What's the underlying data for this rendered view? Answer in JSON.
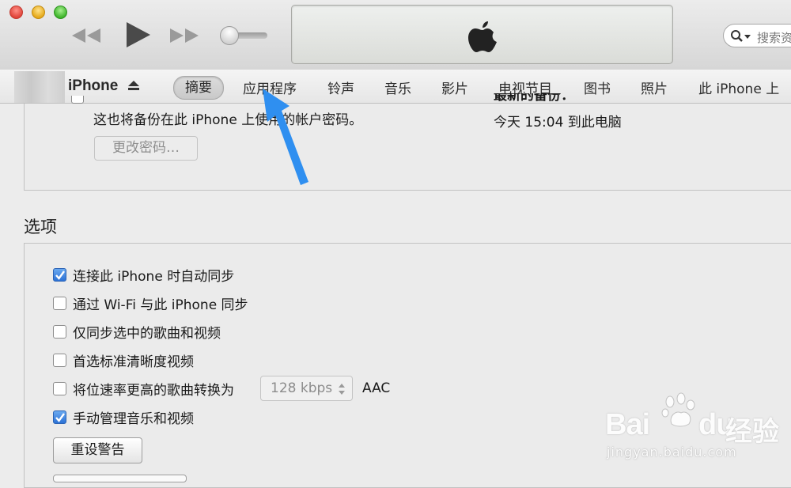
{
  "toolbar": {
    "search_placeholder": "搜索资"
  },
  "device": {
    "name": "iPhone"
  },
  "tabs": [
    {
      "label": "摘要",
      "active": true
    },
    {
      "label": "应用程序"
    },
    {
      "label": "铃声"
    },
    {
      "label": "音乐"
    },
    {
      "label": "影片"
    },
    {
      "label": "电视节目"
    },
    {
      "label": "图书"
    },
    {
      "label": "照片"
    },
    {
      "label": "此 iPhone 上"
    }
  ],
  "backup": {
    "note": "这也将备份在此 iPhone 上使用的帐户密码。",
    "change_password_label": "更改密码…",
    "latest_backup_label": "最新的备份：",
    "latest_backup_value": "今天 15:04 到此电脑"
  },
  "options": {
    "title": "选项",
    "items": [
      {
        "label": "连接此 iPhone 时自动同步",
        "checked": true
      },
      {
        "label": "通过 Wi-Fi 与此 iPhone 同步",
        "checked": false
      },
      {
        "label": "仅同步选中的歌曲和视频",
        "checked": false
      },
      {
        "label": "首选标准清晰度视频",
        "checked": false
      },
      {
        "label": "将位速率更高的歌曲转换为",
        "checked": false
      },
      {
        "label": "手动管理音乐和视频",
        "checked": true
      }
    ],
    "bitrate_value": "128 kbps",
    "codec": "AAC",
    "reset_warnings_label": "重设警告"
  },
  "watermark": {
    "brand": "Bai",
    "brand_suffix": "du",
    "brand_cn": "经验",
    "url": "jingyan.baidu.com"
  },
  "colors": {
    "accent_blue": "#2d72d6",
    "arrow_blue": "#2f8ff0"
  }
}
